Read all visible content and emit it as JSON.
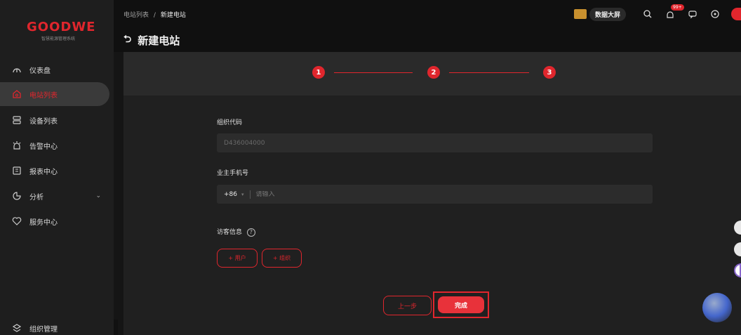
{
  "logo": {
    "main": "GOODWE",
    "sub": "智慧能源管理系统"
  },
  "sidebar": {
    "items": [
      {
        "label": "仪表盘",
        "icon": "dashboard-icon"
      },
      {
        "label": "电站列表",
        "icon": "home-icon",
        "active": true
      },
      {
        "label": "设备列表",
        "icon": "device-icon"
      },
      {
        "label": "告警中心",
        "icon": "alarm-icon"
      },
      {
        "label": "报表中心",
        "icon": "report-icon"
      },
      {
        "label": "分析",
        "icon": "analysis-icon"
      },
      {
        "label": "服务中心",
        "icon": "service-icon"
      }
    ],
    "bottom": {
      "label": "组织管理",
      "icon": "organization-icon"
    }
  },
  "header": {
    "breadcrumb": {
      "parent": "电站列表",
      "separator": "/",
      "current": "新建电站"
    },
    "title": "新建电站",
    "big_screen_label": "数据大屏",
    "notification_badge": "99+"
  },
  "steps": [
    "1",
    "2",
    "3"
  ],
  "form": {
    "org_code_label": "组织代码",
    "org_code_value": "D436004000",
    "owner_phone_label": "业主手机号",
    "phone_prefix": "+86",
    "phone_placeholder": "请输入",
    "visitor_info_label": "访客信息",
    "add_user_label": "+ 用户",
    "add_org_label": "+ 组织"
  },
  "actions": {
    "prev_label": "上一步",
    "finish_label": "完成"
  },
  "colors": {
    "accent": "#e0262d",
    "bg": "#151515"
  }
}
